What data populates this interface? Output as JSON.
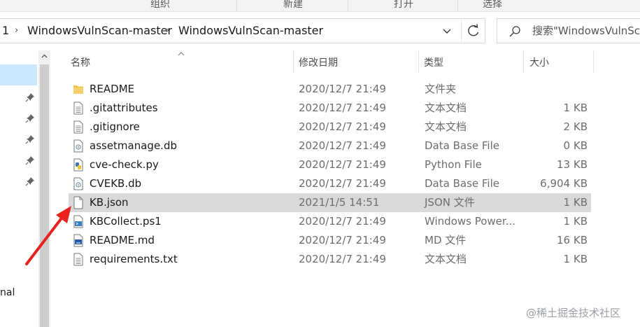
{
  "ribbon": {
    "groups": [
      "组织",
      "新建",
      "打开",
      "选择"
    ]
  },
  "address": {
    "crumbs": [
      "1",
      "WindowsVulnScan-master",
      "WindowsVulnScan-master"
    ],
    "separator": "›"
  },
  "search": {
    "placeholder": "搜索\"WindowsVulnSc"
  },
  "nav": {
    "partial_label": "nal"
  },
  "columns": {
    "name": "名称",
    "date": "修改日期",
    "type": "类型",
    "size": "大小"
  },
  "files": [
    {
      "name": "README",
      "date": "2020/12/7 21:49",
      "type": "文件夹",
      "size": "",
      "icon": "folder-icon"
    },
    {
      "name": ".gitattributes",
      "date": "2020/12/7 21:49",
      "type": "文本文档",
      "size": "1 KB",
      "icon": "text-file-icon"
    },
    {
      "name": ".gitignore",
      "date": "2020/12/7 21:49",
      "type": "文本文档",
      "size": "2 KB",
      "icon": "text-file-icon"
    },
    {
      "name": "assetmanage.db",
      "date": "2020/12/7 21:49",
      "type": "Data Base File",
      "size": "0 KB",
      "icon": "db-file-icon"
    },
    {
      "name": "cve-check.py",
      "date": "2020/12/7 21:49",
      "type": "Python File",
      "size": "13 KB",
      "icon": "python-file-icon"
    },
    {
      "name": "CVEKB.db",
      "date": "2020/12/7 21:49",
      "type": "Data Base File",
      "size": "6,904 KB",
      "icon": "db-file-icon"
    },
    {
      "name": "KB.json",
      "date": "2021/1/5 14:51",
      "type": "JSON 文件",
      "size": "1 KB",
      "icon": "blank-file-icon",
      "selected": true
    },
    {
      "name": "KBCollect.ps1",
      "date": "2020/12/7 21:49",
      "type": "Windows Power...",
      "size": "1 KB",
      "icon": "powershell-file-icon"
    },
    {
      "name": "README.md",
      "date": "2020/12/7 21:49",
      "type": "MD 文件",
      "size": "16 KB",
      "icon": "md-file-icon"
    },
    {
      "name": "requirements.txt",
      "date": "2020/12/7 21:49",
      "type": "文本文档",
      "size": "1 KB",
      "icon": "text-file-icon"
    }
  ],
  "watermark": "@稀土掘金技术社区",
  "colors": {
    "selected_row": "#d9d9d9",
    "nav_selected": "#cce8ff",
    "annotation_arrow": "#e8231f",
    "folder": "#f0c24b"
  }
}
